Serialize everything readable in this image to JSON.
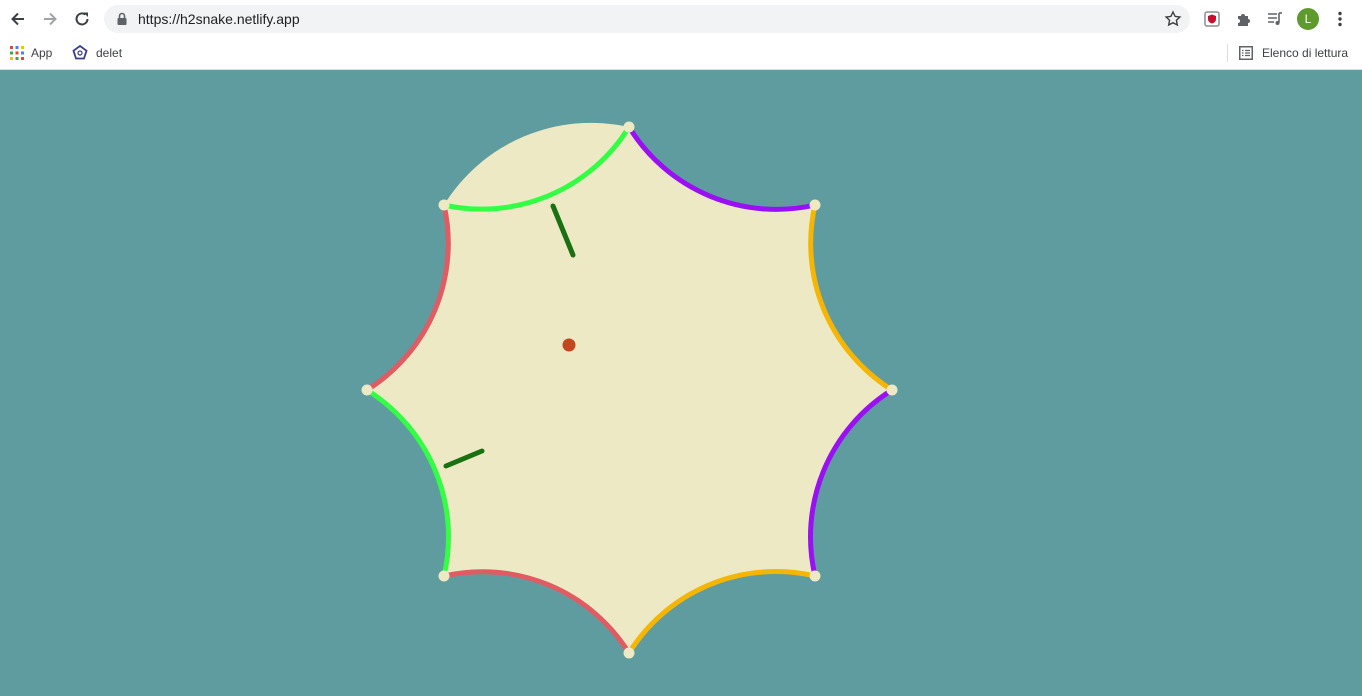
{
  "browser": {
    "url": "https://h2snake.netlify.app",
    "profile_initial": "L",
    "bookmarks": [
      {
        "label": "App",
        "icon": "apps-grid-icon"
      },
      {
        "label": "delet",
        "icon": "pentagon-icon"
      }
    ],
    "reading_list_label": "Elenco di lettura"
  },
  "game": {
    "background_color": "#5f9c9f",
    "board_fill": "#ede9c4",
    "vertex_color": "#ede9c4",
    "wall_colors": [
      "#33ff44",
      "#9b0ff5",
      "#f6b500",
      "#9b0ff5",
      "#f6b500",
      "#e15b63",
      "#33ff44",
      "#e15b63"
    ],
    "snake_color": "#197112",
    "food_color": "#c2461e"
  }
}
